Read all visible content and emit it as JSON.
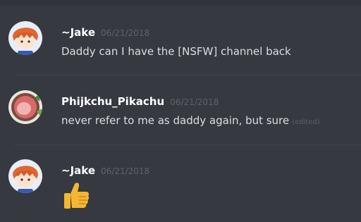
{
  "messages": [
    {
      "author": "~Jake",
      "timestamp": "06/21/2018",
      "text": "Daddy can I have the [NSFW] channel back",
      "edited": ""
    },
    {
      "author": "Phijkchu_Pikachu",
      "timestamp": "06/21/2018",
      "text": "never refer to me as daddy again, but sure",
      "edited": "(edited)"
    },
    {
      "author": "~Jake",
      "timestamp": "06/21/2018",
      "emoji": "thumbs-up-icon"
    }
  ],
  "colors": {
    "background": "#36393f",
    "author": "#ffffff",
    "message_text": "#dcddde",
    "timestamp": "#5e6269"
  }
}
